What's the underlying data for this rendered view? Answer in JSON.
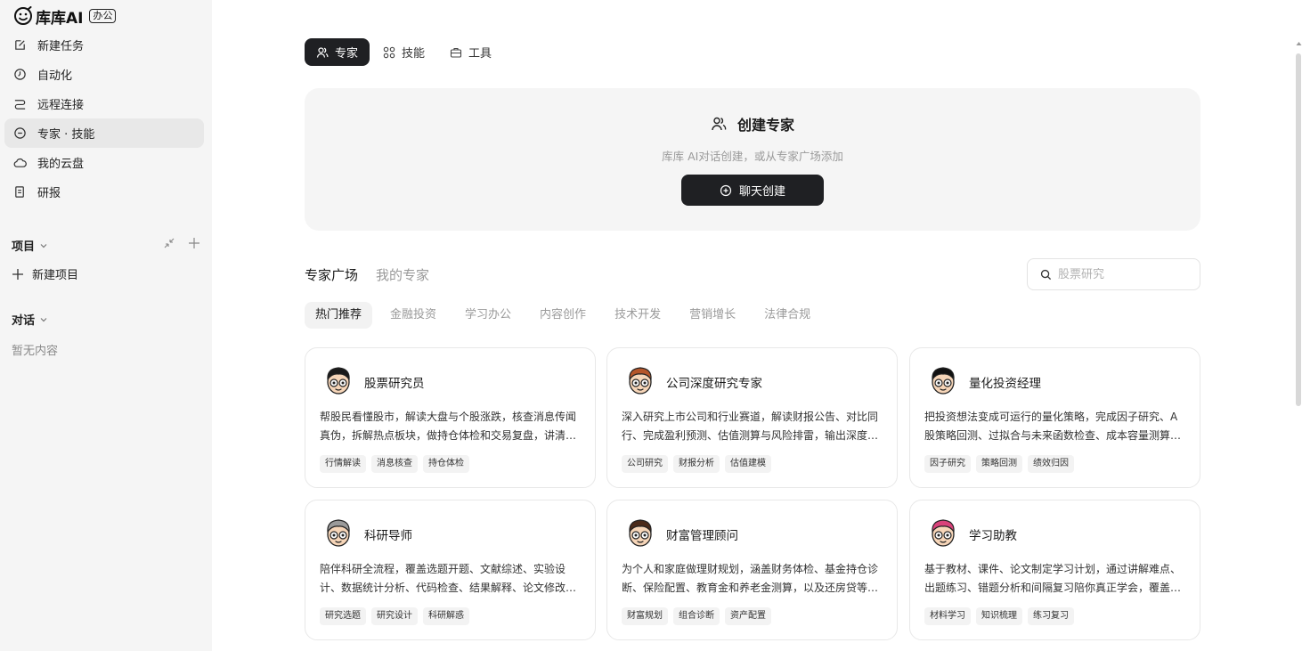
{
  "app": {
    "logo_text": "库库AI",
    "logo_badge": "办公"
  },
  "sidebar": {
    "nav": [
      {
        "label": "新建任务",
        "icon": "edit-icon"
      },
      {
        "label": "自动化",
        "icon": "clock-icon"
      },
      {
        "label": "远程连接",
        "icon": "route-icon"
      },
      {
        "label": "专家 · 技能",
        "icon": "expert-icon",
        "active": true
      },
      {
        "label": "我的云盘",
        "icon": "cloud-icon"
      },
      {
        "label": "研报",
        "icon": "report-icon"
      }
    ],
    "projects_label": "项目",
    "new_project_label": "新建项目",
    "conversations_label": "对话",
    "empty_label": "暂无内容"
  },
  "main": {
    "tabs": [
      {
        "label": "专家",
        "icon": "users-icon",
        "active": true
      },
      {
        "label": "技能",
        "icon": "grid-icon"
      },
      {
        "label": "工具",
        "icon": "toolbox-icon"
      }
    ],
    "create": {
      "title": "创建专家",
      "subtitle": "库库 AI对话创建，或从专家广场添加",
      "button": "聊天创建"
    },
    "sub_tabs": [
      {
        "label": "专家广场",
        "active": true
      },
      {
        "label": "我的专家"
      }
    ],
    "search": {
      "placeholder": "股票研究"
    },
    "categories": [
      {
        "label": "热门推荐",
        "active": true
      },
      {
        "label": "金融投资"
      },
      {
        "label": "学习办公"
      },
      {
        "label": "内容创作"
      },
      {
        "label": "技术开发"
      },
      {
        "label": "营销增长"
      },
      {
        "label": "法律合规"
      }
    ],
    "cards": [
      {
        "title": "股票研究员",
        "desc": "帮股民看懂股市，解读大盘与个股涨跌，核查消息传闻真伪，拆解热点板块，做持仓体检和交易复盘，讲清楚逻辑与风险",
        "tags": [
          "行情解读",
          "消息核查",
          "持仓体检"
        ],
        "hair": "#1a1a1a",
        "skin": "#f6d5b8"
      },
      {
        "title": "公司深度研究专家",
        "desc": "深入研究上市公司和行业赛道，解读财报公告、对比同行、完成盈利预测、估值测算与风险排雷，输出深度研究报告",
        "tags": [
          "公司研究",
          "财报分析",
          "估值建模"
        ],
        "hair": "#b5562a",
        "skin": "#f6d5b8"
      },
      {
        "title": "量化投资经理",
        "desc": "把投资想法变成可运行的量化策略，完成因子研究、A股策略回测、过拟合与未来函数检查、成本容量测算与组合优化",
        "tags": [
          "因子研究",
          "策略回测",
          "绩效归因"
        ],
        "hair": "#111111",
        "skin": "#f6d5b8"
      },
      {
        "title": "科研导师",
        "desc": "陪伴科研全流程，覆盖选题开题、文献综述、实验设计、数据统计分析、代码检查、结果解释、论文修改与投稿答辩",
        "tags": [
          "研究选题",
          "研究设计",
          "科研解惑"
        ],
        "hair": "#9a9a9a",
        "skin": "#f6d5b8"
      },
      {
        "title": "财富管理顾问",
        "desc": "为个人和家庭做理财规划，涵盖财务体检、基金持仓诊断、保险配置、教育金和养老金测算，以及还房贷等决策",
        "tags": [
          "财富规划",
          "组合诊断",
          "资产配置"
        ],
        "hair": "#4a2a1a",
        "skin": "#f6d5b8"
      },
      {
        "title": "学习助教",
        "desc": "基于教材、课件、论文制定学习计划，通过讲解难点、出题练习、错题分析和间隔复习陪你真正学会，覆盖多学科",
        "tags": [
          "材料学习",
          "知识梳理",
          "练习复习"
        ],
        "hair": "#d9427a",
        "skin": "#f6d5b8"
      }
    ]
  }
}
